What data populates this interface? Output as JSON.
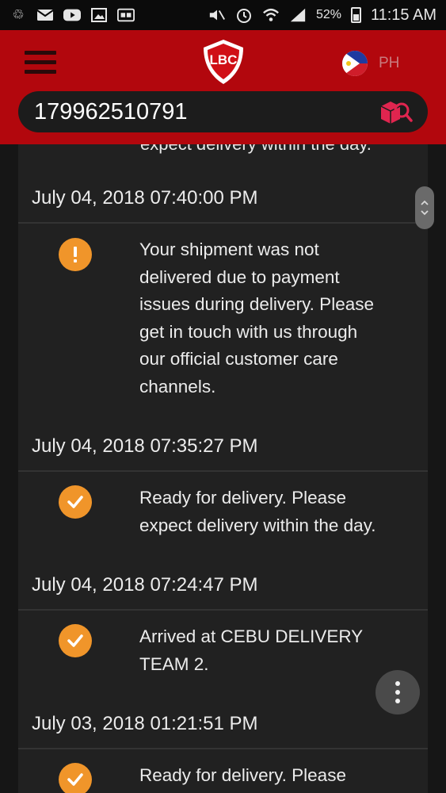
{
  "status_bar": {
    "battery": "52%",
    "time": "11:15 AM",
    "icons": [
      "sync-icon",
      "mail-icon",
      "youtube-icon",
      "gallery-icon",
      "ge-icon",
      "mute-icon",
      "alarm-icon",
      "wifi-icon",
      "signal-icon",
      "battery-icon"
    ]
  },
  "header": {
    "logo_text": "LBC",
    "language_code": "PH",
    "brand_color": "#b2070d"
  },
  "search": {
    "value": "179962510791",
    "icon": "package-search-icon"
  },
  "timeline": {
    "cut_text": "expect delivery within the day.",
    "events": [
      {
        "date": "July 04, 2018 07:40:00 PM",
        "status": "warning",
        "icon": "exclamation-icon",
        "lines": [
          "Your shipment was not",
          "delivered due to payment",
          "issues during delivery. Please",
          "get in touch with us through",
          "our official customer care",
          "channels."
        ]
      },
      {
        "date": "July 04, 2018 07:35:27 PM",
        "status": "done",
        "icon": "check-icon",
        "lines": [
          "Ready for delivery. Please",
          "expect delivery within the day."
        ]
      },
      {
        "date": "July 04, 2018 07:24:47 PM",
        "status": "done",
        "icon": "check-icon",
        "lines": [
          "Arrived at CEBU DELIVERY",
          "TEAM 2."
        ]
      },
      {
        "date": "July 03, 2018 01:21:51 PM",
        "status": "done",
        "icon": "check-icon",
        "lines": [
          "Ready for delivery. Please"
        ]
      }
    ]
  },
  "colors": {
    "status_orange": "#f0952a",
    "panel_bg": "#212121"
  }
}
